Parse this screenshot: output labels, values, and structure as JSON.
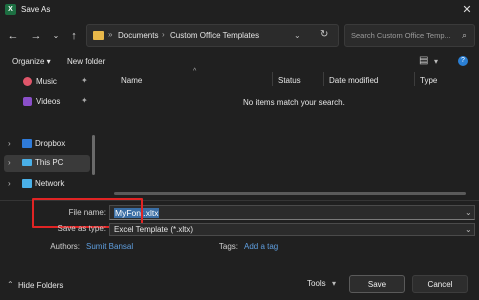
{
  "window": {
    "title": "Save As",
    "app_icon": "excel-icon"
  },
  "nav": {
    "breadcrumb_sep": "»",
    "path": [
      "Documents",
      "Custom Office Templates"
    ],
    "search_placeholder": "Search Custom Office Temp..."
  },
  "toolbar": {
    "organize_label": "Organize ▾",
    "new_folder_label": "New folder"
  },
  "sidebar": {
    "items": [
      {
        "label": "Music",
        "icon": "music-icon",
        "pinned": true
      },
      {
        "label": "Videos",
        "icon": "videos-icon",
        "pinned": true
      },
      {
        "label": "Dropbox",
        "icon": "dropbox-icon"
      },
      {
        "label": "This PC",
        "icon": "pc-icon",
        "selected": true
      },
      {
        "label": "Network",
        "icon": "network-icon"
      }
    ]
  },
  "file_list": {
    "columns": [
      "Name",
      "Status",
      "Date modified",
      "Type"
    ],
    "empty_message": "No items match your search."
  },
  "form": {
    "file_name_label": "File name:",
    "file_name_value": "MyFont.xltx",
    "save_type_label": "Save as type:",
    "save_type_value": "Excel Template (*.xltx)",
    "authors_label": "Authors:",
    "authors_value": "Sumit Bansal",
    "tags_label": "Tags:",
    "tags_value": "Add a tag"
  },
  "footer": {
    "hide_folders_label": "Hide Folders",
    "tools_label": "Tools",
    "save_label": "Save",
    "cancel_label": "Cancel"
  },
  "colors": {
    "highlight": "#e02424",
    "link": "#5f9fe0",
    "background": "#202020"
  }
}
